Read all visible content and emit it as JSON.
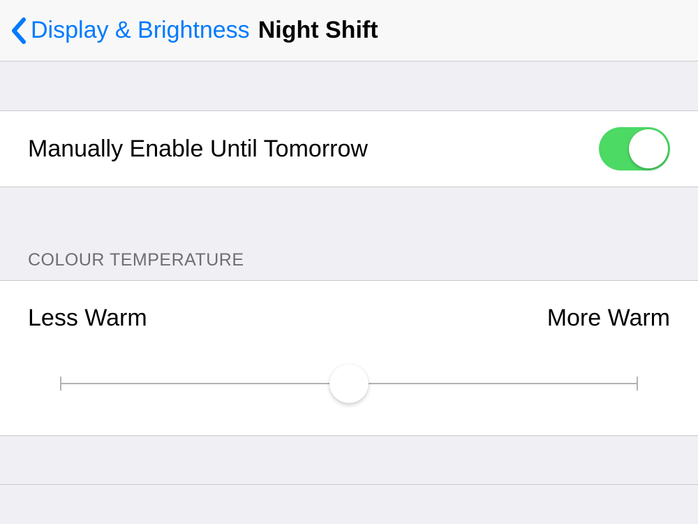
{
  "nav": {
    "back_label": "Display & Brightness",
    "title": "Night Shift"
  },
  "manual_toggle": {
    "label": "Manually Enable Until Tomorrow",
    "on": true
  },
  "colour_temp": {
    "header": "Colour Temperature",
    "min_label": "Less Warm",
    "max_label": "More Warm",
    "value_percent": 50
  },
  "colors": {
    "tint": "#007aff",
    "switch_on": "#4cd964"
  }
}
